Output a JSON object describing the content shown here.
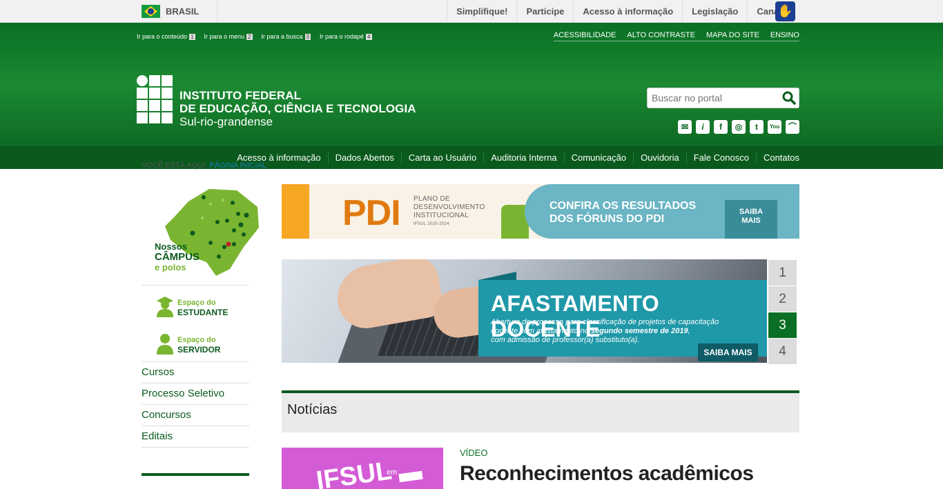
{
  "gov_bar": {
    "country": "BRASIL",
    "links": [
      "Simplifique!",
      "Participe",
      "Acesso à informação",
      "Legislação",
      "Canais"
    ]
  },
  "header": {
    "skip_links": [
      {
        "label": "Ir para o conteúdo",
        "key": "1"
      },
      {
        "label": "Ir para o menu",
        "key": "2"
      },
      {
        "label": "Ir para a busca",
        "key": "3"
      },
      {
        "label": "Ir para o rodapé",
        "key": "4"
      }
    ],
    "utility_links": [
      "ACESSIBILIDADE",
      "ALTO CONTRASTE",
      "MAPA DO SITE",
      "ENSINO"
    ],
    "logo": {
      "line1": "INSTITUTO FEDERAL",
      "line2": "DE EDUCAÇÃO, CIÊNCIA E TECNOLOGIA",
      "line3": "Sul-rio-grandense"
    },
    "search": {
      "placeholder": "Buscar no portal"
    },
    "social_icons": [
      "email-icon",
      "info-icon",
      "facebook-icon",
      "instagram-icon",
      "twitter-icon",
      "youtube-icon",
      "rss-icon"
    ]
  },
  "nav": {
    "items": [
      "Acesso à informação",
      "Dados Abertos",
      "Carta ao Usuário",
      "Auditoria Interna",
      "Comunicação",
      "Ouvidoria",
      "Fale Conosco",
      "Contatos"
    ]
  },
  "breadcrumb": {
    "prefix": "VOCÊ ESTÁ AQUI:",
    "current": "PÁGINA INICIAL"
  },
  "sidebar": {
    "campus": {
      "line1": "Nossos",
      "line2": "CÂMPUS",
      "line3": "e polos"
    },
    "estudante": {
      "small": "Espaço do",
      "big": "ESTUDANTE"
    },
    "servidor": {
      "small": "Espaço do",
      "big": "SERVIDOR"
    },
    "links": [
      "Cursos",
      "Processo Seletivo",
      "Concursos",
      "Editais"
    ]
  },
  "pdi_banner": {
    "big": "PDI",
    "sub1": "PLANO DE",
    "sub2": "DESENVOLVIMENTO",
    "sub3": "INSTITUCIONAL",
    "sub4": "IFSUL 2020-2024",
    "cta1": "CONFIRA OS RESULTADOS",
    "cta2": "DOS FÓRUNS DO PDI",
    "button1": "SAIBA",
    "button2": "MAIS"
  },
  "carousel": {
    "title": "AFASTAMENTO DOCENTE",
    "desc1": "Abertura de processo para classificação de projetos de capacitação",
    "desc2a": "docente com afastamento no ",
    "desc2b": "segundo semestre de 2019",
    "desc2c": ",",
    "desc3": "com admissão de professor(a) substituto(a).",
    "button": "SAIBA MAIS",
    "pages": [
      "1",
      "2",
      "3",
      "4"
    ],
    "active_page": "3"
  },
  "noticias": {
    "heading": "Notícias",
    "category": "VÍDEO",
    "title": "Reconhecimentos acadêmicos",
    "thumb_text": "IFSUL",
    "thumb_em": "em"
  },
  "colors": {
    "brand_green": "#0a5a1d",
    "accent_green": "#7ab531",
    "teal": "#1f98a8"
  }
}
